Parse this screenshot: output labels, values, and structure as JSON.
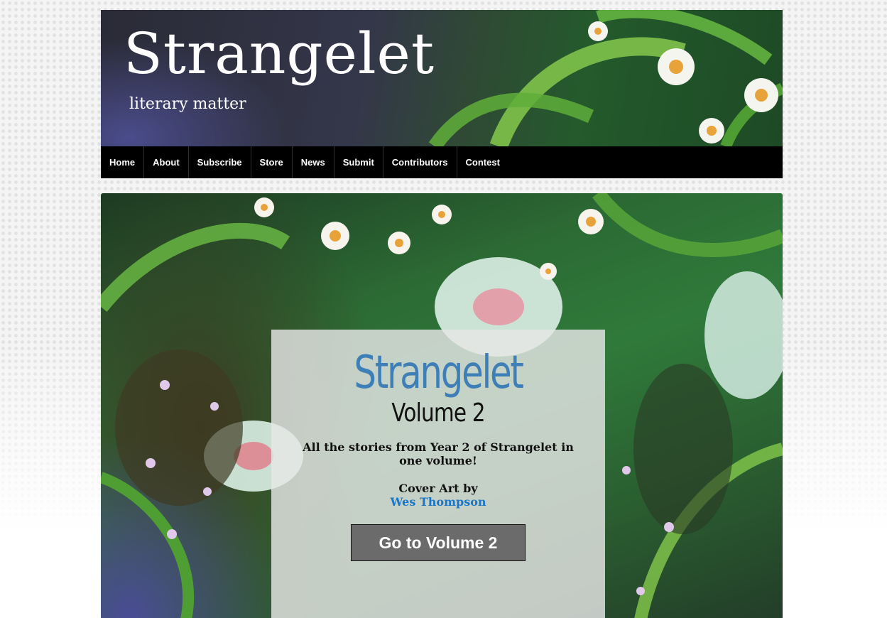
{
  "header": {
    "logo_title": "Strangelet",
    "logo_subtitle": "literary matter"
  },
  "nav": {
    "items": [
      "Home",
      "About",
      "Subscribe",
      "Store",
      "News",
      "Submit",
      "Contributors",
      "Contest"
    ]
  },
  "hero": {
    "title": "Strangelet",
    "volume": "Volume 2",
    "description": "All the stories from Year 2 of Strangelet in one volume!",
    "cover_art_label": "Cover Art by",
    "artist": "Wes Thompson",
    "button_label": "Go to Volume 2"
  },
  "colors": {
    "title_blue": "#3f7fb7",
    "link_blue": "#1a76c8",
    "nav_bg": "#000000",
    "button_bg": "#6b6b6b"
  }
}
